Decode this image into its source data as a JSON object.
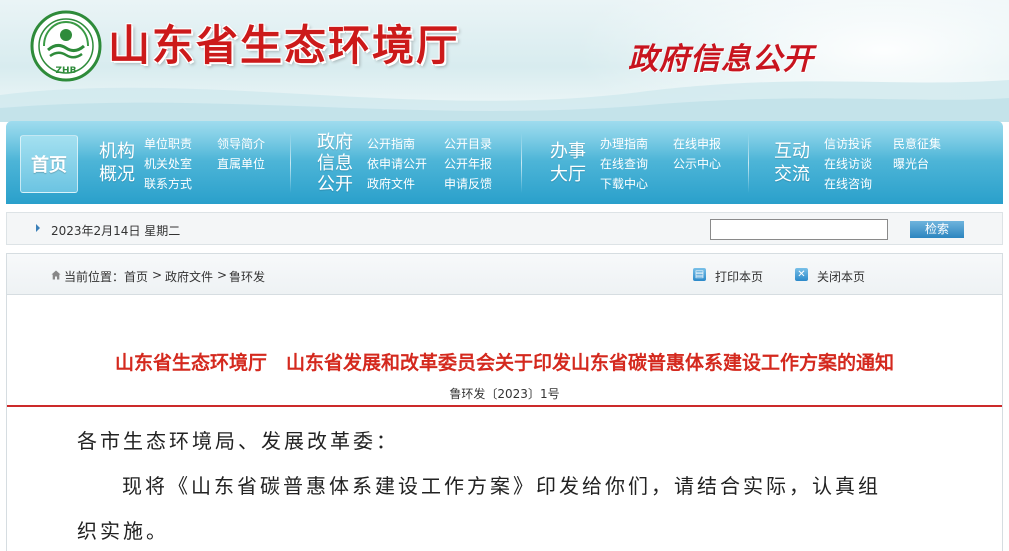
{
  "banner": {
    "site_title": "山东省生态环境厅",
    "subtitle": "政府信息公开",
    "logo_text": "ZHB"
  },
  "nav": {
    "home": "首页",
    "groups": [
      {
        "title_lines": [
          "机构",
          "概况"
        ],
        "links": [
          "单位职责",
          "领导简介",
          "机关处室",
          "直属单位",
          "联系方式"
        ]
      },
      {
        "title_lines": [
          "政府",
          "信息",
          "公开"
        ],
        "links": [
          "公开指南",
          "公开目录",
          "依申请公开",
          "公开年报",
          "政府文件",
          "申请反馈"
        ]
      },
      {
        "title_lines": [
          "办事",
          "大厅"
        ],
        "links": [
          "办理指南",
          "在线申报",
          "在线查询",
          "公示中心",
          "下载中心"
        ]
      },
      {
        "title_lines": [
          "互动",
          "交流"
        ],
        "links": [
          "信访投诉",
          "民意征集",
          "在线访谈",
          "曝光台",
          "在线咨询"
        ]
      }
    ]
  },
  "infobar": {
    "date": "2023年2月14日 星期二",
    "search_value": "",
    "search_button": "检索"
  },
  "breadcrumb": {
    "prefix": "当前位置：",
    "items": [
      "首页",
      "政府文件",
      "鲁环发"
    ],
    "separator": ">"
  },
  "tools": {
    "print": "打印本页",
    "close": "关闭本页"
  },
  "article": {
    "title": "山东省生态环境厅　山东省发展和改革委员会关于印发山东省碳普惠体系建设工作方案的通知",
    "doc_number": "鲁环发〔2023〕1号",
    "salutation": "各市生态环境局、发展改革委：",
    "body_line1": "现将《山东省碳普惠体系建设工作方案》印发给你们，请结合实际，认真组",
    "body_line2": "织实施。"
  },
  "colors": {
    "title_red": "#cc1a1a",
    "nav_blue": "#2aa0cb",
    "article_title": "#d4291e"
  }
}
